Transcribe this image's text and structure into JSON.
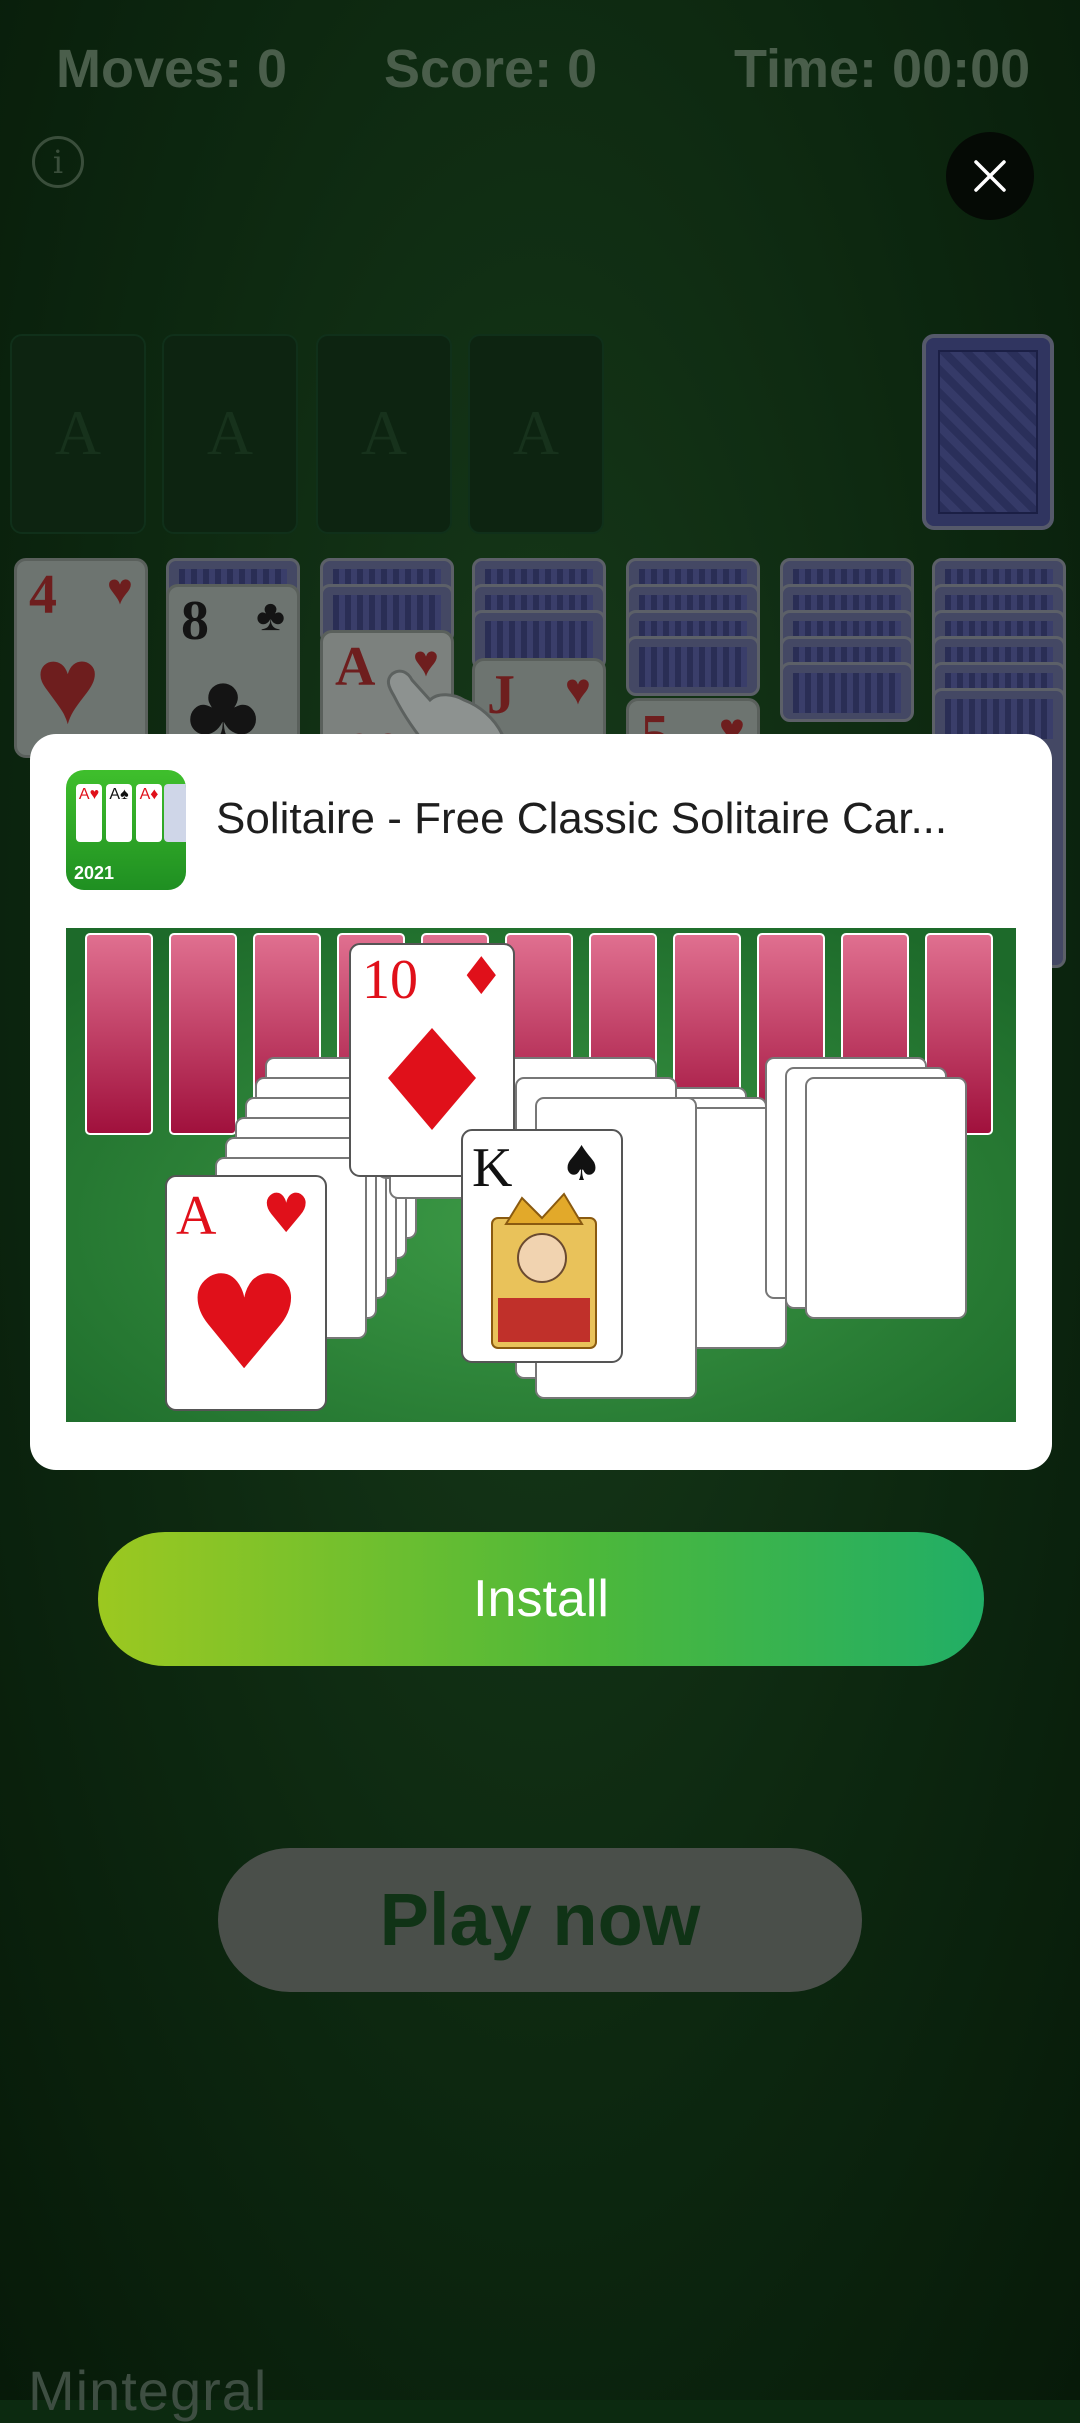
{
  "header": {
    "moves": "Moves: 0",
    "score": "Score: 0",
    "time": "Time:  00:00",
    "info_glyph": "i"
  },
  "foundations": {
    "slot_labels": [
      "A",
      "A",
      "A",
      "A"
    ]
  },
  "tableau": {
    "col1": {
      "rank": "4",
      "suit": "♥"
    },
    "col2": {
      "rank": "8",
      "suit": "♣"
    },
    "col3": {
      "rank": "A",
      "suit": "♥"
    },
    "col4": {
      "rank": "J",
      "suit": "♥"
    },
    "col5": {
      "rank": "5",
      "suit": "♥"
    }
  },
  "ad": {
    "app_title": "Solitaire - Free Classic Solitaire Car...",
    "icon_year": "2021",
    "banner_cards": {
      "ten": {
        "rank": "10",
        "suit": "♦"
      },
      "king": {
        "rank": "K",
        "suit": "♠"
      },
      "ace": {
        "rank": "A",
        "suit": "♥"
      }
    }
  },
  "install_label": "Install",
  "play_label": "Play now",
  "brand": "Mintegral",
  "colors": {
    "background": "#0c2a10",
    "install_start": "#9cc820",
    "install_end": "#21ae66",
    "card_red": "#e0101a"
  },
  "icons": [
    "info-icon",
    "close-icon",
    "hand-pointer-icon"
  ]
}
